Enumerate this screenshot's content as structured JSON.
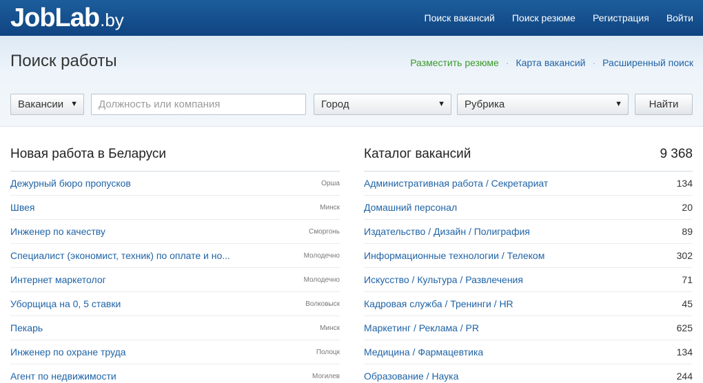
{
  "header": {
    "logo_main": "JobLab",
    "logo_tld": ".by",
    "nav": [
      "Поиск вакансий",
      "Поиск резюме",
      "Регистрация",
      "Войти"
    ]
  },
  "subheader": {
    "title": "Поиск работы",
    "links": [
      "Разместить резюме",
      "Карта вакансий",
      "Расширенный поиск"
    ],
    "separator": "·"
  },
  "search": {
    "type_value": "Вакансии",
    "query_placeholder": "Должность или компания",
    "city_value": "Город",
    "rubric_value": "Рубрика",
    "submit_label": "Найти",
    "arrow": "▼"
  },
  "new_jobs": {
    "title": "Новая работа в Беларуси",
    "items": [
      {
        "title": "Дежурный бюро пропусков",
        "city": "Орша"
      },
      {
        "title": "Швея",
        "city": "Минск"
      },
      {
        "title": "Инженер по качеству",
        "city": "Сморгонь"
      },
      {
        "title": "Специалист (экономист, техник) по оплате и но...",
        "city": "Молодечно"
      },
      {
        "title": "Интернет маркетолог",
        "city": "Молодечно"
      },
      {
        "title": "Уборщица на 0, 5 ставки",
        "city": "Волковыск"
      },
      {
        "title": "Пекарь",
        "city": "Минск"
      },
      {
        "title": "Инженер по охране труда",
        "city": "Полоцк"
      },
      {
        "title": "Агент по недвижимости",
        "city": "Могилев"
      }
    ]
  },
  "catalog": {
    "title": "Каталог вакансий",
    "total": "9 368",
    "items": [
      {
        "name": "Административная работа / Секретариат",
        "count": "134"
      },
      {
        "name": "Домашний персонал",
        "count": "20"
      },
      {
        "name": "Издательство / Дизайн / Полиграфия",
        "count": "89"
      },
      {
        "name": "Информационные технологии / Телеком",
        "count": "302"
      },
      {
        "name": "Искусство / Культура / Развлечения",
        "count": "71"
      },
      {
        "name": "Кадровая служба / Тренинги / HR",
        "count": "45"
      },
      {
        "name": "Маркетинг / Реклама / PR",
        "count": "625"
      },
      {
        "name": "Медицина / Фармацевтика",
        "count": "134"
      },
      {
        "name": "Образование / Наука",
        "count": "244"
      }
    ]
  }
}
